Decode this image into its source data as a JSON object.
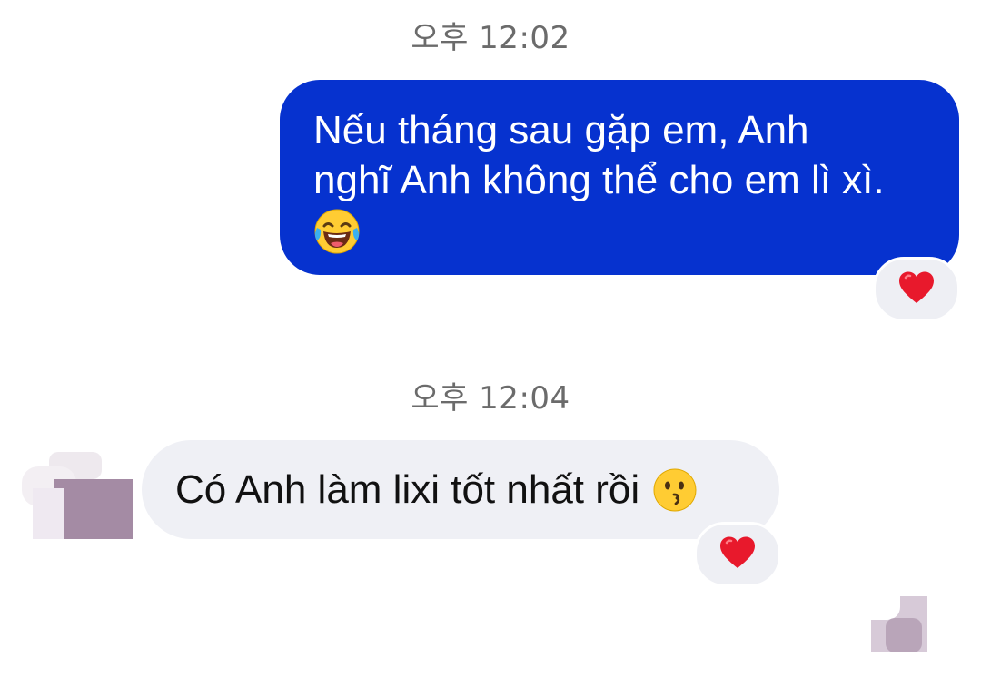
{
  "timestamps": {
    "first": "오후 12:02",
    "second": "오후 12:04"
  },
  "messages": [
    {
      "direction": "sent",
      "lines": [
        "Nếu tháng sau gặp em, Anh",
        "nghĩ Anh không thể cho em lì xì."
      ],
      "emoji": "face-with-tears-of-joy",
      "reaction": "heart"
    },
    {
      "direction": "received",
      "text": "Có Anh làm lixi tốt nhất rồi",
      "emoji": "kissing-face",
      "reaction": "heart"
    }
  ],
  "colors": {
    "sent_bubble": "#0632cf",
    "received_bubble": "#eff0f5",
    "reaction_pill": "#eeeff4",
    "heart": "#e8192c",
    "timestamp_text": "#6b6b6b"
  }
}
